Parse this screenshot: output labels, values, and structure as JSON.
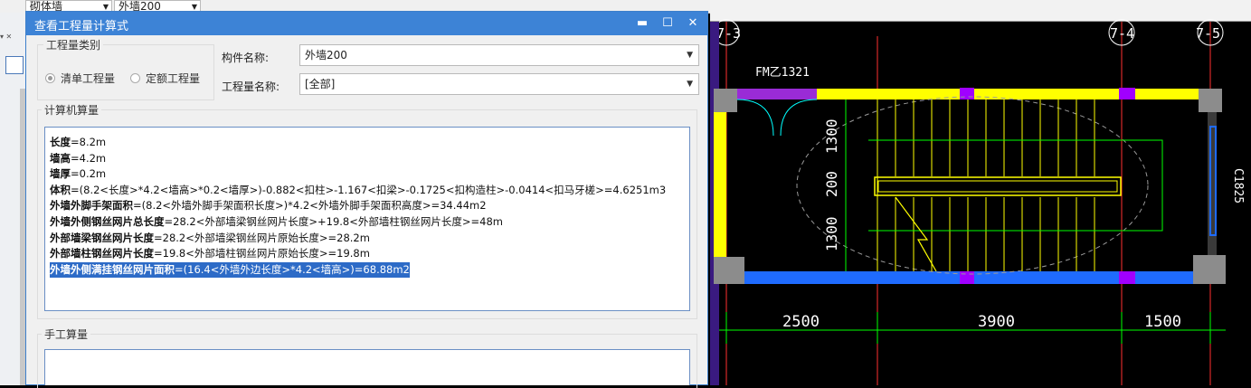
{
  "toolbar": {
    "wall_type": "砌体墙",
    "wall_name": "外墙200"
  },
  "dialog": {
    "title": "查看工程量计算式",
    "quantity_type": {
      "label": "工程量类别",
      "options": [
        "清单工程量",
        "定额工程量"
      ],
      "selected": "清单工程量"
    },
    "component_name": {
      "label": "构件名称:",
      "value": "外墙200"
    },
    "quantity_name": {
      "label": "工程量名称:",
      "value": "[全部]"
    },
    "computer_calc": {
      "label": "计算机算量",
      "lines": [
        {
          "key": "长度",
          "expr": "=8.2m"
        },
        {
          "key": "墙高",
          "expr": "=4.2m"
        },
        {
          "key": "墙厚",
          "expr": "=0.2m"
        },
        {
          "key": "体积",
          "expr": "=(8.2<长度>*4.2<墙高>*0.2<墙厚>)-0.882<扣柱>-1.167<扣梁>-0.1725<扣构造柱>-0.0414<扣马牙槎>=4.6251m3"
        },
        {
          "key": "外墙外脚手架面积",
          "expr": "=(8.2<外墙外脚手架面积长度>)*4.2<外墙外脚手架面积高度>=34.44m2"
        },
        {
          "key": "外墙外侧钢丝网片总长度",
          "expr": "=28.2<外部墙梁钢丝网片长度>+19.8<外部墙柱钢丝网片长度>=48m"
        },
        {
          "key": "外部墙梁钢丝网片长度",
          "expr": "=28.2<外部墙梁钢丝网片原始长度>=28.2m"
        },
        {
          "key": "外部墙柱钢丝网片长度",
          "expr": "=19.8<外部墙柱钢丝网片原始长度>=19.8m"
        },
        {
          "key": "外墙外侧满挂钢丝网片面积",
          "expr": "=(16.4<外墙外边长度>*4.2<墙高>)=68.88m2"
        }
      ]
    },
    "manual_calc": {
      "label": "手工算量"
    }
  },
  "cad": {
    "axis_labels": [
      "7-3",
      "7-4",
      "7-5"
    ],
    "door_label": "FM乙1321",
    "window_label": "C1825",
    "dimensions_vertical": [
      "1300",
      "200",
      "1300"
    ],
    "dimensions_horizontal": [
      "2500",
      "3900",
      "1500"
    ],
    "colors": {
      "wall": "#ffff00",
      "column": "#8c8c8c",
      "axis": "#ff3030",
      "dimension": "#00ff00",
      "window": "#2060ff",
      "opening": "#a000ff"
    }
  }
}
